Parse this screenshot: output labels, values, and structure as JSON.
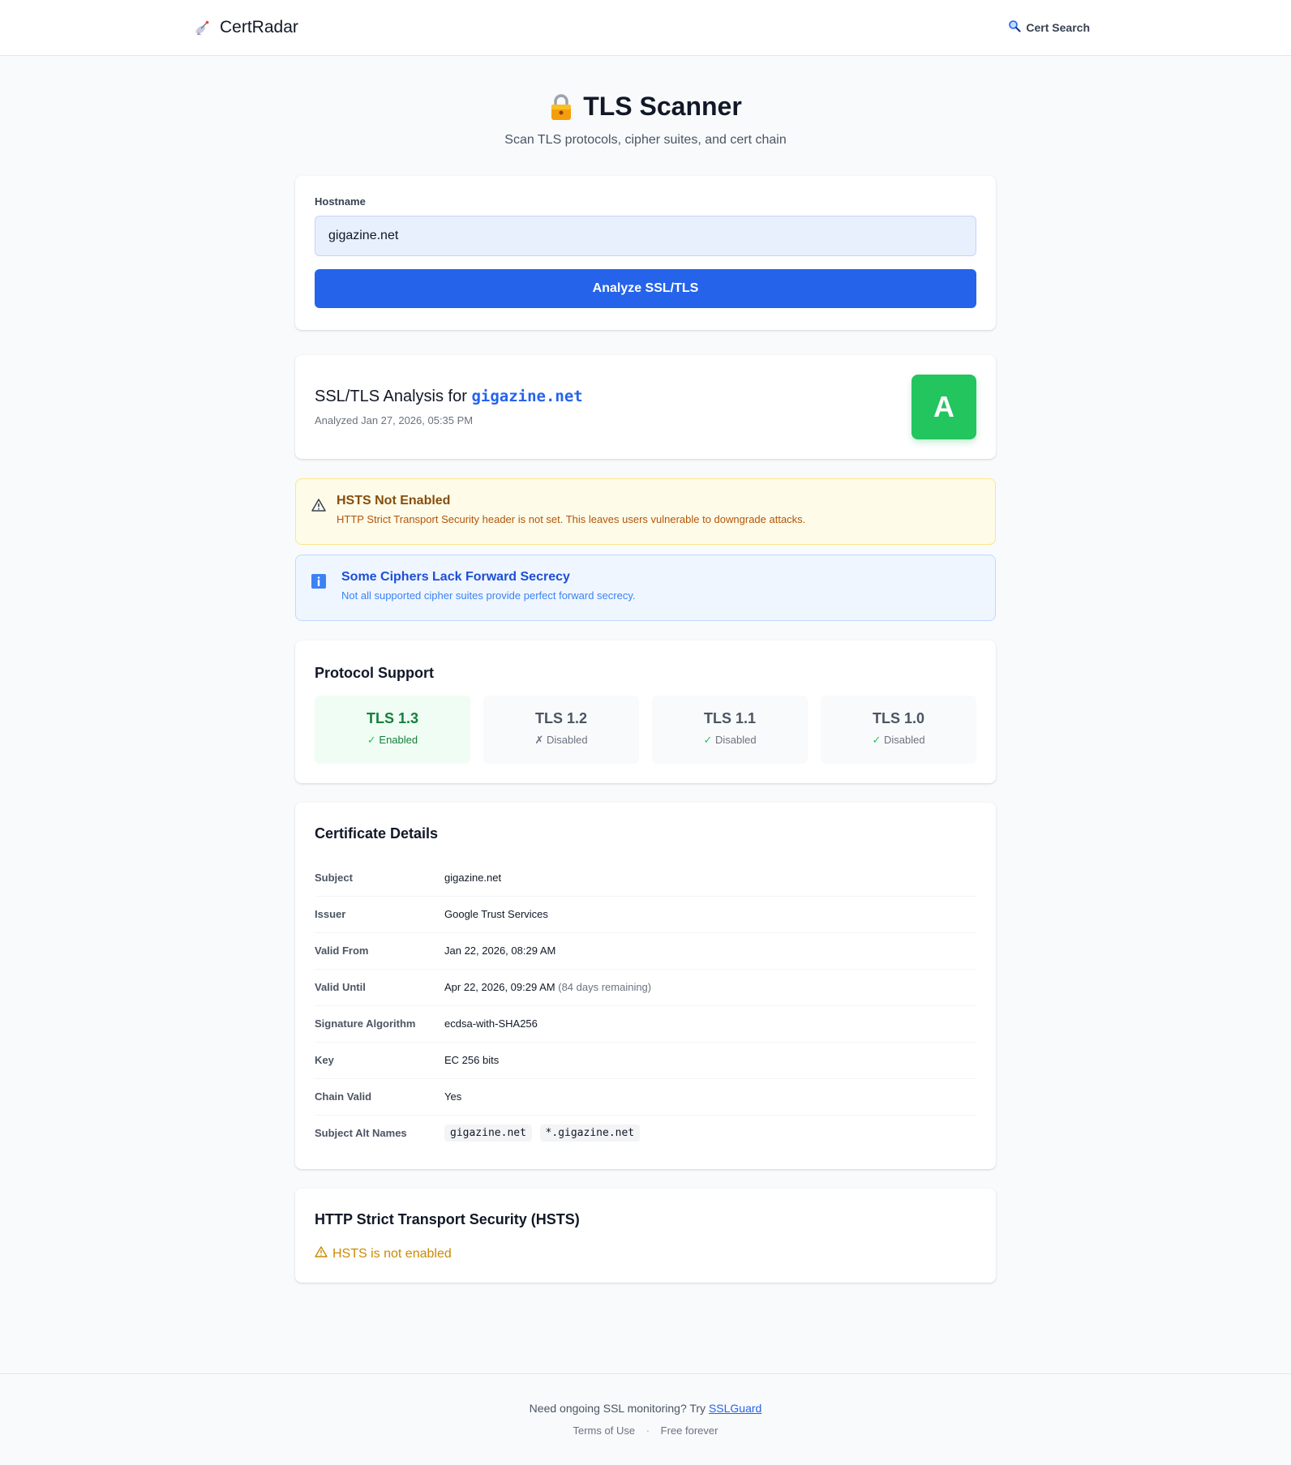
{
  "header": {
    "brand": "CertRadar",
    "brand_icon": "satellite-dish-icon",
    "nav_search": "Cert Search",
    "nav_search_icon": "magnifier-icon"
  },
  "hero": {
    "title": "TLS Scanner",
    "subtitle": "Scan TLS protocols, cipher suites, and cert chain",
    "icon": "lock-icon"
  },
  "form": {
    "label": "Hostname",
    "value": "gigazine.net",
    "button": "Analyze SSL/TLS"
  },
  "analysis": {
    "prefix": "SSL/TLS Analysis for",
    "host": "gigazine.net",
    "date": "Analyzed Jan 27, 2026, 05:35 PM",
    "grade": "A",
    "grade_color": "#22c55e"
  },
  "alerts": {
    "warn": {
      "title": "HSTS Not Enabled",
      "desc": "HTTP Strict Transport Security header is not set. This leaves users vulnerable to downgrade attacks."
    },
    "info": {
      "title": "Some Ciphers Lack Forward Secrecy",
      "desc": "Not all supported cipher suites provide perfect forward secrecy."
    }
  },
  "protocols": {
    "title": "Protocol Support",
    "items": [
      {
        "name": "TLS 1.3",
        "mark": "✓",
        "status": "Enabled"
      },
      {
        "name": "TLS 1.2",
        "mark": "✗",
        "status": "Disabled"
      },
      {
        "name": "TLS 1.1",
        "mark": "✓",
        "status": "Disabled"
      },
      {
        "name": "TLS 1.0",
        "mark": "✓",
        "status": "Disabled"
      }
    ]
  },
  "certificate": {
    "title": "Certificate Details",
    "rows": {
      "subject": {
        "label": "Subject",
        "value": "gigazine.net"
      },
      "issuer": {
        "label": "Issuer",
        "value": "Google Trust Services"
      },
      "valid_from": {
        "label": "Valid From",
        "value": "Jan 22, 2026, 08:29 AM"
      },
      "valid_until": {
        "label": "Valid Until",
        "value": "Apr 22, 2026, 09:29 AM",
        "note": "(84 days remaining)"
      },
      "sig_alg": {
        "label": "Signature Algorithm",
        "value": "ecdsa-with-SHA256"
      },
      "key": {
        "label": "Key",
        "value": "EC 256 bits"
      },
      "chain": {
        "label": "Chain Valid",
        "value": "Yes"
      },
      "sans": {
        "label": "Subject Alt Names",
        "values": [
          "gigazine.net",
          "*.gigazine.net"
        ]
      }
    }
  },
  "hsts": {
    "title": "HTTP Strict Transport Security (HSTS)",
    "status": "HSTS is not enabled"
  },
  "footer": {
    "text": "Need ongoing SSL monitoring? Try",
    "link": "SSLGuard",
    "terms": "Terms of Use",
    "sep": "·",
    "free": "Free forever"
  }
}
